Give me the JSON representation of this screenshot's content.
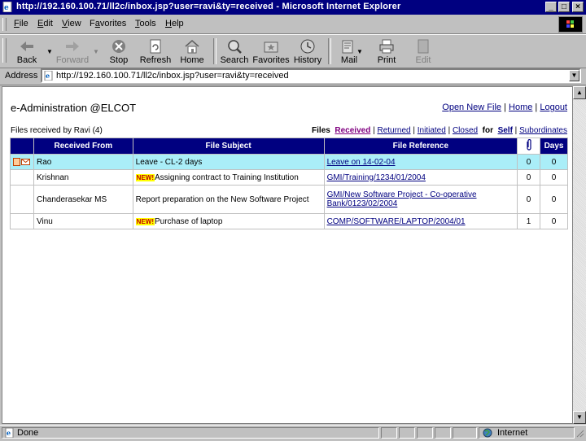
{
  "window": {
    "title": "http://192.160.100.71/ll2c/inbox.jsp?user=ravi&ty=received - Microsoft Internet Explorer",
    "minimize": "_",
    "maximize": "□",
    "close": "×"
  },
  "menu": {
    "items": [
      {
        "label": "File",
        "u": "F",
        "rest": "ile"
      },
      {
        "label": "Edit",
        "u": "E",
        "rest": "dit"
      },
      {
        "label": "View",
        "u": "V",
        "rest": "iew"
      },
      {
        "label": "Favorites",
        "u": "a",
        "pre": "F",
        "rest": "vorites"
      },
      {
        "label": "Tools",
        "u": "T",
        "rest": "ools"
      },
      {
        "label": "Help",
        "u": "H",
        "rest": "elp"
      }
    ]
  },
  "toolbar": {
    "back": "Back",
    "forward": "Forward",
    "stop": "Stop",
    "refresh": "Refresh",
    "home": "Home",
    "search": "Search",
    "favorites": "Favorites",
    "history": "History",
    "mail": "Mail",
    "print": "Print",
    "edit": "Edit"
  },
  "address": {
    "label": "Address",
    "url": "http://192.160.100.71/ll2c/inbox.jsp?user=ravi&ty=received"
  },
  "page": {
    "title": "e-Administration @ELCOT",
    "links": {
      "open_new_file": "Open New File",
      "home": "Home",
      "logout": "Logout"
    },
    "received_label": "Files received by Ravi  (4)",
    "filters": {
      "files_label": "Files",
      "received": "Received",
      "returned": "Returned",
      "initiated": "Initiated",
      "closed": "Closed",
      "for_label": "for",
      "self": "Self",
      "subordinates": "Subordinates"
    }
  },
  "table": {
    "headers": {
      "from": "Received From",
      "subject": "File Subject",
      "reference": "File Reference",
      "days": "Days"
    },
    "new_badge": "NEW!",
    "rows": [
      {
        "from": "Rao",
        "subject": "Leave - CL-2 days",
        "new": false,
        "reference": "Leave on 14-02-04",
        "attachments": "0",
        "days": "0",
        "selected": true
      },
      {
        "from": "Krishnan",
        "subject": "Assigning contract to Training Institution",
        "new": true,
        "reference": "GMI/Training/1234/01/2004",
        "attachments": "0",
        "days": "0",
        "selected": false
      },
      {
        "from": "Chanderasekar MS",
        "subject": "Report preparation on the New Software Project",
        "new": false,
        "reference": "GMI/New Software Project - Co-operative Bank/0123/02/2004",
        "attachments": "0",
        "days": "0",
        "selected": false
      },
      {
        "from": "Vinu",
        "subject": "Purchase of laptop",
        "new": true,
        "reference": "COMP/SOFTWARE/LAPTOP/2004/01",
        "attachments": "1",
        "days": "0",
        "selected": false
      }
    ]
  },
  "status": {
    "text": "Done",
    "zone": "Internet"
  },
  "colors": {
    "titlebar": "#000080",
    "header": "#000080",
    "selected_row": "#aaeef8",
    "link": "#000080"
  }
}
